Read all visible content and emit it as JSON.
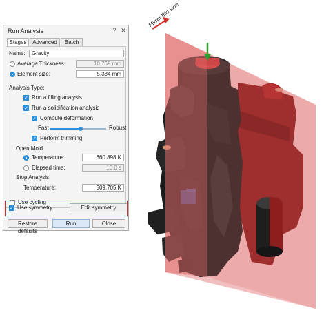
{
  "viewport": {
    "mirror_label": "Mirror this side",
    "mirror_color": "#d94a4a",
    "part_color": "#1c1c1c",
    "arrow_icon": "green-down-arrow-icon"
  },
  "panel": {
    "title": "Run Analysis",
    "tabs": [
      "Stages",
      "Advanced",
      "Batch"
    ],
    "name_label": "Name:",
    "name_value": "Gravity",
    "avg_thickness_label": "Average Thickness",
    "avg_thickness_value": "10.769 mm",
    "element_size_label": "Element size:",
    "element_size_value": "5.384 mm",
    "analysis_type_label": "Analysis Type:",
    "filling_label": "Run a filling analysis",
    "solidification_label": "Run a solidification analysis",
    "compute_deformation_label": "Compute deformation",
    "fast_label": "Fast",
    "robust_label": "Robust",
    "slider_level": 0.55,
    "perform_trimming_label": "Perform trimming",
    "open_mold_label": "Open Mold",
    "temperature_label": "Temperature:",
    "temperature_value": "660.898 K",
    "elapsed_label": "Elapsed time:",
    "elapsed_value": "10.0 s",
    "stop_analysis_label": "Stop Analysis",
    "stop_temperature_label": "Temperature:",
    "stop_temperature_value": "509.705 K",
    "use_cycling_label": "Use cycling",
    "use_symmetry_label": "Use symmetry",
    "edit_symmetry_label": "Edit symmetry",
    "restore_label": "Restore defaults",
    "run_label": "Run",
    "close_label": "Close",
    "accent": "#2d8fd8",
    "highlight_color": "#d42a2a"
  }
}
